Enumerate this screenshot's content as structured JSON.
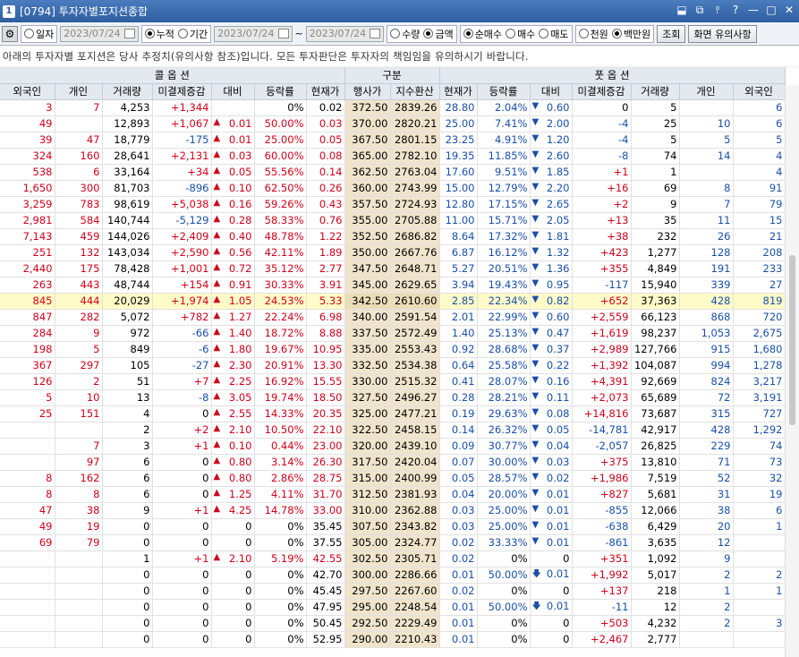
{
  "window": {
    "id": "1",
    "title": "[0794] 투자자별포지션종합",
    "buttons": [
      "⬓",
      "⧉",
      "⫯",
      "?",
      "—",
      "□",
      "✕"
    ]
  },
  "toolbar": {
    "gear": "⚙",
    "period": [
      {
        "label": "일자",
        "on": false
      }
    ],
    "date1": "2023/07/24",
    "cum": [
      {
        "label": "누적",
        "on": true
      },
      {
        "label": "기간",
        "on": false
      }
    ],
    "date2": "2023/07/24",
    "tilde": "~",
    "date3": "2023/07/24",
    "qty": [
      {
        "label": "수량",
        "on": false
      },
      {
        "label": "금액",
        "on": true
      }
    ],
    "side": [
      {
        "label": "순매수",
        "on": true
      },
      {
        "label": "매수",
        "on": false
      },
      {
        "label": "매도",
        "on": false
      }
    ],
    "unit": [
      {
        "label": "천원",
        "on": false
      },
      {
        "label": "백만원",
        "on": true
      }
    ],
    "query_btn": "조회",
    "screen_btn": "화면 유의사항"
  },
  "notice": "아래의 투자자별 포지션은 당사 추정치(유의사항 참조)입니다. 모든 투자판단은 투자자의 책임임을 유의하시기 바랍니다.",
  "headers": {
    "call": "콜 옵 션",
    "mid": "구분",
    "put": "풋 옵 션",
    "cols": [
      "외국인",
      "개인",
      "거래량",
      "미결제증감",
      "대비",
      "등락률",
      "현재가",
      "행사가",
      "지수환산",
      "현재가",
      "등락률",
      "대비",
      "미결제증감",
      "거래량",
      "개인",
      "외국인"
    ]
  },
  "rows": [
    {
      "c": [
        "3",
        "7",
        "4,253",
        "+1,344",
        "",
        "0%",
        "0.02",
        "372.50",
        "2839.26",
        "28.80",
        "2.04%",
        "0.60",
        "0",
        "5",
        "",
        "6"
      ],
      "ca": "",
      "pa": "dn"
    },
    {
      "c": [
        "49",
        "",
        "12,893",
        "+1,067",
        "0.01",
        "50.00%",
        "0.03",
        "370.00",
        "2820.21",
        "25.00",
        "7.41%",
        "2.00",
        "-4",
        "25",
        "10",
        "6"
      ],
      "ca": "up",
      "pa": "dn"
    },
    {
      "c": [
        "39",
        "47",
        "18,779",
        "-175",
        "0.01",
        "25.00%",
        "0.05",
        "367.50",
        "2801.15",
        "23.25",
        "4.91%",
        "1.20",
        "-4",
        "5",
        "5",
        "5"
      ],
      "ca": "up",
      "pa": "dn"
    },
    {
      "c": [
        "324",
        "160",
        "28,641",
        "+2,131",
        "0.03",
        "60.00%",
        "0.08",
        "365.00",
        "2782.10",
        "19.35",
        "11.85%",
        "2.60",
        "-8",
        "74",
        "14",
        "4"
      ],
      "ca": "up",
      "pa": "dn"
    },
    {
      "c": [
        "538",
        "6",
        "33,164",
        "+34",
        "0.05",
        "55.56%",
        "0.14",
        "362.50",
        "2763.04",
        "17.60",
        "9.51%",
        "1.85",
        "+1",
        "1",
        "",
        "4"
      ],
      "ca": "up",
      "pa": "dn"
    },
    {
      "c": [
        "1,650",
        "300",
        "81,703",
        "-896",
        "0.10",
        "62.50%",
        "0.26",
        "360.00",
        "2743.99",
        "15.00",
        "12.79%",
        "2.20",
        "+16",
        "69",
        "8",
        "91"
      ],
      "ca": "up",
      "pa": "dn"
    },
    {
      "c": [
        "3,259",
        "783",
        "98,619",
        "+5,038",
        "0.16",
        "59.26%",
        "0.43",
        "357.50",
        "2724.93",
        "12.80",
        "17.15%",
        "2.65",
        "+2",
        "9",
        "7",
        "79"
      ],
      "ca": "up",
      "pa": "dn"
    },
    {
      "c": [
        "2,981",
        "584",
        "140,744",
        "-5,129",
        "0.28",
        "58.33%",
        "0.76",
        "355.00",
        "2705.88",
        "11.00",
        "15.71%",
        "2.05",
        "+13",
        "35",
        "11",
        "15"
      ],
      "ca": "up",
      "pa": "dn"
    },
    {
      "c": [
        "7,143",
        "459",
        "144,026",
        "+2,409",
        "0.40",
        "48.78%",
        "1.22",
        "352.50",
        "2686.82",
        "8.64",
        "17.32%",
        "1.81",
        "+38",
        "232",
        "26",
        "21"
      ],
      "ca": "up",
      "pa": "dn"
    },
    {
      "c": [
        "251",
        "132",
        "143,034",
        "+2,590",
        "0.56",
        "42.11%",
        "1.89",
        "350.00",
        "2667.76",
        "6.87",
        "16.12%",
        "1.32",
        "+423",
        "1,277",
        "128",
        "208"
      ],
      "ca": "up",
      "pa": "dn"
    },
    {
      "c": [
        "2,440",
        "175",
        "78,428",
        "+1,001",
        "0.72",
        "35.12%",
        "2.77",
        "347.50",
        "2648.71",
        "5.27",
        "20.51%",
        "1.36",
        "+355",
        "4,849",
        "191",
        "233"
      ],
      "ca": "up",
      "pa": "dn"
    },
    {
      "c": [
        "263",
        "443",
        "48,744",
        "+154",
        "0.91",
        "30.33%",
        "3.91",
        "345.00",
        "2629.65",
        "3.94",
        "19.43%",
        "0.95",
        "-117",
        "15,940",
        "339",
        "27"
      ],
      "ca": "up",
      "pa": "dn"
    },
    {
      "c": [
        "845",
        "444",
        "20,029",
        "+1,974",
        "1.05",
        "24.53%",
        "5.33",
        "342.50",
        "2610.60",
        "2.85",
        "22.34%",
        "0.82",
        "+652",
        "37,363",
        "428",
        "819"
      ],
      "ca": "up",
      "pa": "dn",
      "atm": true
    },
    {
      "c": [
        "847",
        "282",
        "5,072",
        "+782",
        "1.27",
        "22.24%",
        "6.98",
        "340.00",
        "2591.54",
        "2.01",
        "22.99%",
        "0.60",
        "+2,559",
        "66,123",
        "868",
        "720"
      ],
      "ca": "up",
      "pa": "dn"
    },
    {
      "c": [
        "284",
        "9",
        "972",
        "-66",
        "1.40",
        "18.72%",
        "8.88",
        "337.50",
        "2572.49",
        "1.40",
        "25.13%",
        "0.47",
        "+1,619",
        "98,237",
        "1,053",
        "2,675"
      ],
      "ca": "up",
      "pa": "dn"
    },
    {
      "c": [
        "198",
        "5",
        "849",
        "-6",
        "1.80",
        "19.67%",
        "10.95",
        "335.00",
        "2553.43",
        "0.92",
        "28.68%",
        "0.37",
        "+2,989",
        "127,766",
        "915",
        "1,680"
      ],
      "ca": "up",
      "pa": "dn"
    },
    {
      "c": [
        "367",
        "297",
        "105",
        "-27",
        "2.30",
        "20.91%",
        "13.30",
        "332.50",
        "2534.38",
        "0.64",
        "25.58%",
        "0.22",
        "+1,392",
        "104,087",
        "994",
        "1,278"
      ],
      "ca": "up",
      "pa": "dn"
    },
    {
      "c": [
        "126",
        "2",
        "51",
        "+7",
        "2.25",
        "16.92%",
        "15.55",
        "330.00",
        "2515.32",
        "0.41",
        "28.07%",
        "0.16",
        "+4,391",
        "92,669",
        "824",
        "3,217"
      ],
      "ca": "up",
      "pa": "dn"
    },
    {
      "c": [
        "5",
        "10",
        "13",
        "-8",
        "3.05",
        "19.74%",
        "18.50",
        "327.50",
        "2496.27",
        "0.28",
        "28.21%",
        "0.11",
        "+2,073",
        "65,689",
        "72",
        "3,191"
      ],
      "ca": "up",
      "pa": "dn"
    },
    {
      "c": [
        "25",
        "151",
        "4",
        "0",
        "2.55",
        "14.33%",
        "20.35",
        "325.00",
        "2477.21",
        "0.19",
        "29.63%",
        "0.08",
        "+14,816",
        "73,687",
        "315",
        "727"
      ],
      "ca": "up",
      "pa": "dn"
    },
    {
      "c": [
        "",
        "",
        "2",
        "+2",
        "2.10",
        "10.50%",
        "22.10",
        "322.50",
        "2458.15",
        "0.14",
        "26.32%",
        "0.05",
        "-14,781",
        "42,917",
        "428",
        "1,292"
      ],
      "ca": "up",
      "pa": "dn"
    },
    {
      "c": [
        "",
        "7",
        "3",
        "+1",
        "0.10",
        "0.44%",
        "23.00",
        "320.00",
        "2439.10",
        "0.09",
        "30.77%",
        "0.04",
        "-2,057",
        "26,825",
        "229",
        "74"
      ],
      "ca": "up",
      "pa": "dn"
    },
    {
      "c": [
        "",
        "97",
        "6",
        "0",
        "0.80",
        "3.14%",
        "26.30",
        "317.50",
        "2420.04",
        "0.07",
        "30.00%",
        "0.03",
        "+375",
        "13,810",
        "71",
        "73"
      ],
      "ca": "up",
      "pa": "dn"
    },
    {
      "c": [
        "8",
        "162",
        "6",
        "0",
        "0.80",
        "2.86%",
        "28.75",
        "315.00",
        "2400.99",
        "0.05",
        "28.57%",
        "0.02",
        "+1,986",
        "7,519",
        "52",
        "32"
      ],
      "ca": "up",
      "pa": "dn"
    },
    {
      "c": [
        "8",
        "8",
        "6",
        "0",
        "1.25",
        "4.11%",
        "31.70",
        "312.50",
        "2381.93",
        "0.04",
        "20.00%",
        "0.01",
        "+827",
        "5,681",
        "31",
        "19"
      ],
      "ca": "up",
      "pa": "dn"
    },
    {
      "c": [
        "47",
        "38",
        "9",
        "+1",
        "4.25",
        "14.78%",
        "33.00",
        "310.00",
        "2362.88",
        "0.03",
        "25.00%",
        "0.01",
        "-855",
        "12,066",
        "38",
        "6"
      ],
      "ca": "up",
      "pa": "dn"
    },
    {
      "c": [
        "49",
        "19",
        "0",
        "0",
        "0",
        "0%",
        "35.45",
        "307.50",
        "2343.82",
        "0.03",
        "25.00%",
        "0.01",
        "-638",
        "6,429",
        "20",
        "1"
      ],
      "ca": "",
      "pa": "dn"
    },
    {
      "c": [
        "69",
        "79",
        "0",
        "0",
        "0",
        "0%",
        "37.55",
        "305.00",
        "2324.77",
        "0.02",
        "33.33%",
        "0.01",
        "-861",
        "3,635",
        "12",
        ""
      ],
      "ca": "",
      "pa": "dn"
    },
    {
      "c": [
        "",
        "",
        "1",
        "+1",
        "2.10",
        "5.19%",
        "42.55",
        "302.50",
        "2305.71",
        "0.02",
        "0%",
        "0",
        "+351",
        "1,092",
        "9",
        ""
      ],
      "ca": "up",
      "pa": ""
    },
    {
      "c": [
        "",
        "",
        "0",
        "0",
        "0",
        "0%",
        "42.70",
        "300.00",
        "2286.66",
        "0.01",
        "50.00%",
        "0.01",
        "+1,992",
        "5,017",
        "2",
        "2"
      ],
      "ca": "",
      "pa": "lo"
    },
    {
      "c": [
        "",
        "",
        "0",
        "0",
        "0",
        "0%",
        "45.45",
        "297.50",
        "2267.60",
        "0.02",
        "0%",
        "0",
        "+137",
        "218",
        "1",
        "1"
      ],
      "ca": "",
      "pa": ""
    },
    {
      "c": [
        "",
        "",
        "0",
        "0",
        "0",
        "0%",
        "47.95",
        "295.00",
        "2248.54",
        "0.01",
        "50.00%",
        "0.01",
        "-11",
        "12",
        "2",
        ""
      ],
      "ca": "",
      "pa": "lo"
    },
    {
      "c": [
        "",
        "",
        "0",
        "0",
        "0",
        "0%",
        "50.45",
        "292.50",
        "2229.49",
        "0.01",
        "0%",
        "0",
        "+503",
        "4,232",
        "2",
        "3"
      ],
      "ca": "",
      "pa": ""
    },
    {
      "c": [
        "",
        "",
        "0",
        "0",
        "0",
        "0%",
        "52.95",
        "290.00",
        "2210.43",
        "0.01",
        "0%",
        "0",
        "+2,467",
        "2,777",
        "",
        ""
      ],
      "ca": "",
      "pa": ""
    }
  ],
  "colors": {
    "up": "#d0021b",
    "down": "#1a4fa8",
    "strike_bg": "#f1e4cc",
    "atm_bg": "#fffbc8"
  }
}
